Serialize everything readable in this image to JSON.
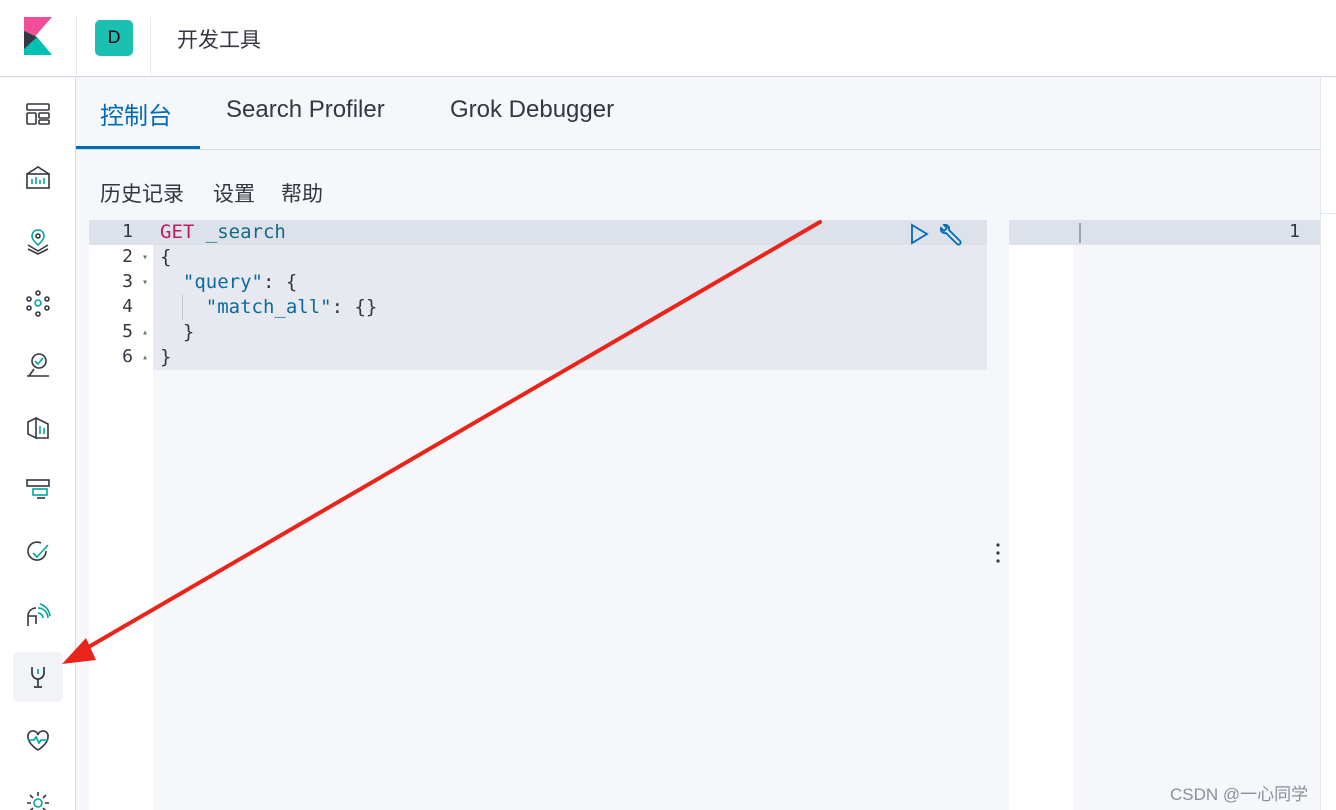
{
  "header": {
    "space_initial": "D",
    "app_title": "开发工具"
  },
  "sidenav": {
    "items": [
      {
        "icon": "dashboard-icon",
        "label": "Dashboard"
      },
      {
        "icon": "visualize-icon",
        "label": "Visualize"
      },
      {
        "icon": "maps-icon",
        "label": "Maps"
      },
      {
        "icon": "ml-icon",
        "label": "Machine Learning"
      },
      {
        "icon": "infrastructure-icon",
        "label": "Infrastructure"
      },
      {
        "icon": "logs-icon",
        "label": "Logs"
      },
      {
        "icon": "apm-icon",
        "label": "APM"
      },
      {
        "icon": "uptime-icon",
        "label": "Uptime"
      },
      {
        "icon": "siem-icon",
        "label": "SIEM"
      },
      {
        "icon": "devtools-icon",
        "label": "Dev Tools",
        "active": true
      },
      {
        "icon": "monitoring-icon",
        "label": "Stack Monitoring"
      },
      {
        "icon": "management-icon",
        "label": "Management"
      }
    ]
  },
  "tabs": [
    {
      "label": "控制台",
      "active": true
    },
    {
      "label": "Search Profiler",
      "active": false
    },
    {
      "label": "Grok Debugger",
      "active": false
    }
  ],
  "toolbar": {
    "history": "历史记录",
    "settings": "设置",
    "help": "帮助"
  },
  "editor": {
    "lines": [
      {
        "num": "1",
        "fold": ""
      },
      {
        "num": "2",
        "fold": "▾"
      },
      {
        "num": "3",
        "fold": "▾"
      },
      {
        "num": "4",
        "fold": ""
      },
      {
        "num": "5",
        "fold": "▴"
      },
      {
        "num": "6",
        "fold": "▴"
      }
    ],
    "method": "GET",
    "url": "_search",
    "open_brace": "{",
    "query_key": "\"query\"",
    "query_rest": ": {",
    "match_all_key": "\"match_all\"",
    "match_all_rest": ": {}",
    "inner_close": "}",
    "outer_close": "}"
  },
  "output": {
    "line_number": "1"
  },
  "colors": {
    "accent": "#006bb8",
    "space_badge": "#1bc0b2",
    "method": "#bd1a5b",
    "arrow": "#e8241b"
  },
  "watermark": "CSDN @一心同学"
}
